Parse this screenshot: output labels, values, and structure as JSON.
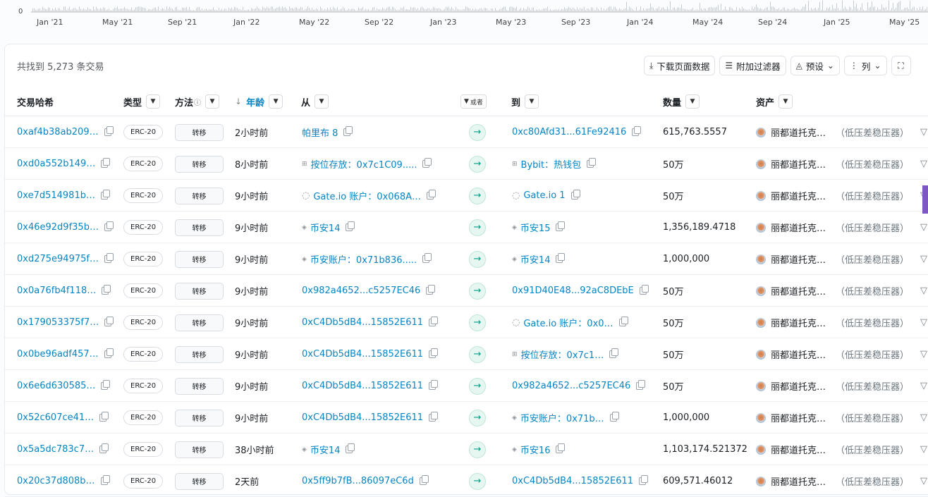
{
  "timeline": {
    "zero_label": "0",
    "ticks": [
      "Jan '21",
      "May '21",
      "Sep '21",
      "Jan '22",
      "May '22",
      "Sep '22",
      "Jan '23",
      "May '23",
      "Sep '23",
      "Jan '24",
      "May '24",
      "Sep '24",
      "Jan '25",
      "May '25"
    ]
  },
  "summary": "共找到 5,273 条交易",
  "toolbar": {
    "download_label": "下载页面数据",
    "filter_label": "附加过滤器",
    "preset_label": "预设",
    "columns_label": "列"
  },
  "columns": {
    "hash": "交易哈希",
    "type": "类型",
    "method": "方法",
    "age": "年龄",
    "from": "从",
    "or_label": "或者",
    "to": "到",
    "amount": "数量",
    "asset": "资产"
  },
  "rows": [
    {
      "hash": "0xaf4b38ab209…",
      "type": "ERC-20",
      "method": "转移",
      "age": "2小时前",
      "from": "帕里布 8",
      "from_icon": "",
      "to": "0xc80Afd31...61Fe92416",
      "to_icon": "",
      "amount": "615,763.5557",
      "asset": "丽都道托克…",
      "symbol": "（低压差稳压器）"
    },
    {
      "hash": "0xd0a552b149…",
      "type": "ERC-20",
      "method": "转移",
      "age": "8小时前",
      "from": "按位存放：0x7c1C09.....",
      "from_icon": "logo-icon",
      "to": "Bybit：热钱包",
      "to_icon": "logo-icon",
      "amount": "50万",
      "asset": "丽都道托克…",
      "symbol": "（低压差稳压器）"
    },
    {
      "hash": "0xe7d514981b…",
      "type": "ERC-20",
      "method": "转移",
      "age": "9小时前",
      "from": "Gate.io 账户：0x068A…",
      "from_icon": "gate-icon",
      "to": "Gate.io 1",
      "to_icon": "gate-icon",
      "amount": "50万",
      "asset": "丽都道托克…",
      "symbol": "（低压差稳压器）"
    },
    {
      "hash": "0x46e92d9f35b…",
      "type": "ERC-20",
      "method": "转移",
      "age": "9小时前",
      "from": "币安14",
      "from_icon": "binance-icon",
      "to": "币安15",
      "to_icon": "binance-icon",
      "amount": "1,356,189.4718",
      "asset": "丽都道托克…",
      "symbol": "（低压差稳压器）"
    },
    {
      "hash": "0xd275e94975f…",
      "type": "ERC-20",
      "method": "转移",
      "age": "9小时前",
      "from": "币安账户：0x71b836.....",
      "from_icon": "binance-icon",
      "to": "币安14",
      "to_icon": "binance-icon",
      "amount": "1,000,000",
      "asset": "丽都道托克…",
      "symbol": "（低压差稳压器）"
    },
    {
      "hash": "0x0a76fb4f118…",
      "type": "ERC-20",
      "method": "转移",
      "age": "9小时前",
      "from": "0x982a4652...c5257EC46",
      "from_icon": "",
      "to": "0x91D40E48...92aC8DEbE",
      "to_icon": "",
      "amount": "50万",
      "asset": "丽都道托克…",
      "symbol": "（低压差稳压器）"
    },
    {
      "hash": "0x179053375f7…",
      "type": "ERC-20",
      "method": "转移",
      "age": "9小时前",
      "from": "0xC4Db5dB4...15852E611",
      "from_icon": "",
      "to": "Gate.io 账户：0x0…",
      "to_icon": "gate-icon",
      "amount": "50万",
      "asset": "丽都道托克…",
      "symbol": "（低压差稳压器）"
    },
    {
      "hash": "0x0be96adf457…",
      "type": "ERC-20",
      "method": "转移",
      "age": "9小时前",
      "from": "0xC4Db5dB4...15852E611",
      "from_icon": "",
      "to": "按位存放：0x7c1…",
      "to_icon": "logo-icon",
      "amount": "50万",
      "asset": "丽都道托克…",
      "symbol": "（低压差稳压器）"
    },
    {
      "hash": "0x6e6d630585…",
      "type": "ERC-20",
      "method": "转移",
      "age": "9小时前",
      "from": "0xC4Db5dB4...15852E611",
      "from_icon": "",
      "to": "0x982a4652...c5257EC46",
      "to_icon": "",
      "amount": "50万",
      "asset": "丽都道托克…",
      "symbol": "（低压差稳压器）"
    },
    {
      "hash": "0x52c607ce41…",
      "type": "ERC-20",
      "method": "转移",
      "age": "9小时前",
      "from": "0xC4Db5dB4...15852E611",
      "from_icon": "",
      "to": "币安账户：0x71b…",
      "to_icon": "binance-icon",
      "amount": "1,000,000",
      "asset": "丽都道托克…",
      "symbol": "（低压差稳压器）"
    },
    {
      "hash": "0x5a5dc783c7…",
      "type": "ERC-20",
      "method": "转移",
      "age": "38小时前",
      "from": "币安14",
      "from_icon": "binance-icon",
      "to": "币安16",
      "to_icon": "binance-icon",
      "amount": "1,103,174.521372",
      "asset": "丽都道托克…",
      "symbol": "（低压差稳压器）"
    },
    {
      "hash": "0x20c37d808b…",
      "type": "ERC-20",
      "method": "转移",
      "age": "2天前",
      "from": "0x5ff9b7fB...86097eC6d",
      "from_icon": "",
      "to": "0xC4Db5dB4...15852E611",
      "to_icon": "",
      "amount": "609,571.46012",
      "asset": "丽都道托克…",
      "symbol": "（低压差稳压器）"
    }
  ]
}
